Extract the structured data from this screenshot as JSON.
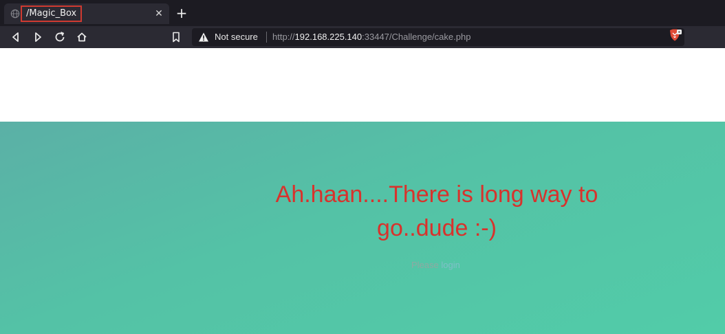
{
  "browser": {
    "tab": {
      "title": "/Magic_Box",
      "close_label": "✕"
    },
    "new_tab_label": "+",
    "toolbar": {
      "security_label": "Not secure",
      "url_scheme": "http://",
      "url_host": "192.168.225.140",
      "url_rest": ":33447/Challenge/cake.php"
    }
  },
  "page": {
    "message": "Ah.haan....There is long way to go..dude :-)",
    "prompt_text": "Please ",
    "login_link": "login"
  },
  "colors": {
    "tab_highlight": "#d03a31",
    "message": "#d8322c",
    "hero_start": "#5bb0a6",
    "hero_end": "#52cca8"
  },
  "icons": [
    "globe-icon",
    "back-icon",
    "forward-icon",
    "reload-icon",
    "home-icon",
    "bookmark-icon",
    "warning-icon",
    "brave-shield-icon"
  ]
}
